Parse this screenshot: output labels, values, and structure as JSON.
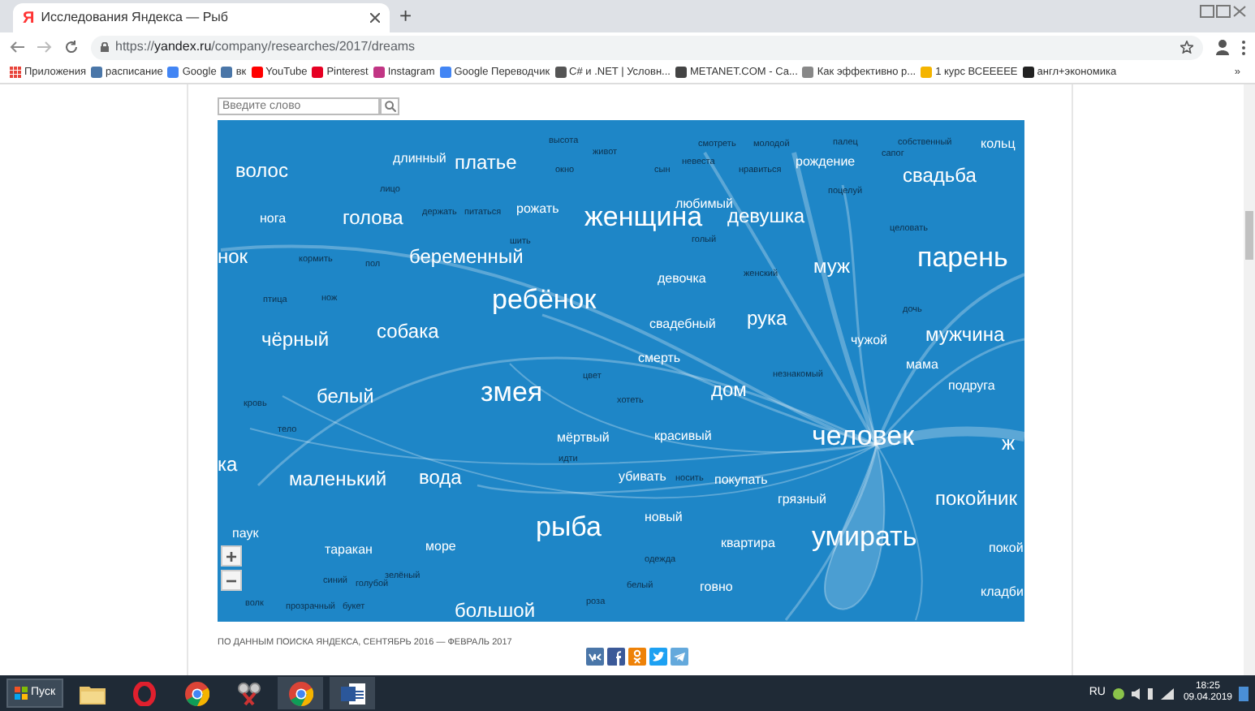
{
  "browser": {
    "favicon": "Я",
    "tab_title": "Исследования Яндекса — Рыб",
    "new_tab": "+",
    "url_scheme": "https://",
    "url_host": "yandex.ru",
    "url_path": "/company/researches/2017/dreams"
  },
  "bookmarks": [
    {
      "label": "Приложения",
      "color": "#e8453c"
    },
    {
      "label": "расписание",
      "color": "#4a76a8"
    },
    {
      "label": "Google",
      "color": "#4285f4"
    },
    {
      "label": "вк",
      "color": "#4a76a8"
    },
    {
      "label": "YouTube",
      "color": "#ff0000"
    },
    {
      "label": "Pinterest",
      "color": "#e60023"
    },
    {
      "label": "Instagram",
      "color": "#c13584"
    },
    {
      "label": "Google Переводчик",
      "color": "#4285f4"
    },
    {
      "label": "C# и .NET | Условн...",
      "color": "#555555"
    },
    {
      "label": "METANET.COM - Са...",
      "color": "#444444"
    },
    {
      "label": "Как эффективно р...",
      "color": "#888888"
    },
    {
      "label": "1 курс  ВСЕЕЕЕЕ",
      "color": "#f4b400"
    },
    {
      "label": "англ+экономика",
      "color": "#222222"
    }
  ],
  "bookmarks_more": "»",
  "search": {
    "placeholder": "Введите слово"
  },
  "map": {
    "zoom_in": "+",
    "zoom_out": "−",
    "words": [
      {
        "text": "высота",
        "kind": "s"
      },
      {
        "text": "смотреть",
        "kind": "s"
      },
      {
        "text": "молодой",
        "kind": "s"
      },
      {
        "text": "палец",
        "kind": "s"
      },
      {
        "text": "собственный",
        "kind": "s"
      },
      {
        "text": "кольц",
        "kind": "m"
      },
      {
        "text": "длинный",
        "kind": "m"
      },
      {
        "text": "платье",
        "kind": "l"
      },
      {
        "text": "живот",
        "kind": "s"
      },
      {
        "text": "невеста",
        "kind": "s"
      },
      {
        "text": "рождение",
        "kind": "m"
      },
      {
        "text": "сапог",
        "kind": "s"
      },
      {
        "text": "волос",
        "kind": "l"
      },
      {
        "text": "окно",
        "kind": "s"
      },
      {
        "text": "сын",
        "kind": "s"
      },
      {
        "text": "нравиться",
        "kind": "s"
      },
      {
        "text": "свадьба",
        "kind": "l"
      },
      {
        "text": "лицо",
        "kind": "s"
      },
      {
        "text": "поцелуй",
        "kind": "s"
      },
      {
        "text": "любимый",
        "kind": "m"
      },
      {
        "text": "нога",
        "kind": "m"
      },
      {
        "text": "голова",
        "kind": "l"
      },
      {
        "text": "держать",
        "kind": "s"
      },
      {
        "text": "питаться",
        "kind": "s"
      },
      {
        "text": "рожать",
        "kind": "m"
      },
      {
        "text": "женщина",
        "kind": "xl"
      },
      {
        "text": "девушка",
        "kind": "l"
      },
      {
        "text": "целовать",
        "kind": "s"
      },
      {
        "text": "шить",
        "kind": "s"
      },
      {
        "text": "голый",
        "kind": "s"
      },
      {
        "text": "нок",
        "kind": "l"
      },
      {
        "text": "кормить",
        "kind": "s"
      },
      {
        "text": "пол",
        "kind": "s"
      },
      {
        "text": "беременный",
        "kind": "l"
      },
      {
        "text": "муж",
        "kind": "l"
      },
      {
        "text": "парень",
        "kind": "xl"
      },
      {
        "text": "девочка",
        "kind": "m"
      },
      {
        "text": "женский",
        "kind": "s"
      },
      {
        "text": "птица",
        "kind": "s"
      },
      {
        "text": "нож",
        "kind": "s"
      },
      {
        "text": "ребёнок",
        "kind": "xl"
      },
      {
        "text": "рука",
        "kind": "l"
      },
      {
        "text": "дочь",
        "kind": "s"
      },
      {
        "text": "чёрный",
        "kind": "l"
      },
      {
        "text": "собака",
        "kind": "l"
      },
      {
        "text": "свадебный",
        "kind": "m"
      },
      {
        "text": "чужой",
        "kind": "m"
      },
      {
        "text": "мужчина",
        "kind": "l"
      },
      {
        "text": "смерть",
        "kind": "m"
      },
      {
        "text": "мама",
        "kind": "m"
      },
      {
        "text": "цвет",
        "kind": "s"
      },
      {
        "text": "незнакомый",
        "kind": "s"
      },
      {
        "text": "кровь",
        "kind": "s"
      },
      {
        "text": "белый",
        "kind": "l"
      },
      {
        "text": "змея",
        "kind": "xl"
      },
      {
        "text": "хотеть",
        "kind": "s"
      },
      {
        "text": "дом",
        "kind": "l"
      },
      {
        "text": "подруга",
        "kind": "m"
      },
      {
        "text": "тело",
        "kind": "s"
      },
      {
        "text": "мёртвый",
        "kind": "m"
      },
      {
        "text": "красивый",
        "kind": "m"
      },
      {
        "text": "человек",
        "kind": "xl"
      },
      {
        "text": "ж",
        "kind": "l"
      },
      {
        "text": "ка",
        "kind": "l"
      },
      {
        "text": "идти",
        "kind": "s"
      },
      {
        "text": "маленький",
        "kind": "l"
      },
      {
        "text": "вода",
        "kind": "l"
      },
      {
        "text": "убивать",
        "kind": "m"
      },
      {
        "text": "носить",
        "kind": "s"
      },
      {
        "text": "покупать",
        "kind": "m"
      },
      {
        "text": "грязный",
        "kind": "m"
      },
      {
        "text": "покойник",
        "kind": "l"
      },
      {
        "text": "паук",
        "kind": "m"
      },
      {
        "text": "таракан",
        "kind": "m"
      },
      {
        "text": "море",
        "kind": "m"
      },
      {
        "text": "рыба",
        "kind": "xl"
      },
      {
        "text": "новый",
        "kind": "m"
      },
      {
        "text": "квартира",
        "kind": "m"
      },
      {
        "text": "умирать",
        "kind": "xl"
      },
      {
        "text": "покой",
        "kind": "m"
      },
      {
        "text": "одежда",
        "kind": "s"
      },
      {
        "text": "синий",
        "kind": "s"
      },
      {
        "text": "голубой",
        "kind": "s"
      },
      {
        "text": "зелёный",
        "kind": "s"
      },
      {
        "text": "белый",
        "kind": "s"
      },
      {
        "text": "говно",
        "kind": "m"
      },
      {
        "text": "кладби",
        "kind": "m"
      },
      {
        "text": "волк",
        "kind": "s"
      },
      {
        "text": "прозрачный",
        "kind": "s"
      },
      {
        "text": "букет",
        "kind": "s"
      },
      {
        "text": "большой",
        "kind": "l"
      },
      {
        "text": "роза",
        "kind": "s"
      }
    ]
  },
  "source_note": "ПО ДАННЫМ ПОИСКА ЯНДЕКСА, СЕНТЯБРЬ 2016 — ФЕВРАЛЬ 2017",
  "taskbar": {
    "start": "Пуск",
    "language": "RU",
    "time": "18:25",
    "date": "09.04.2019"
  }
}
